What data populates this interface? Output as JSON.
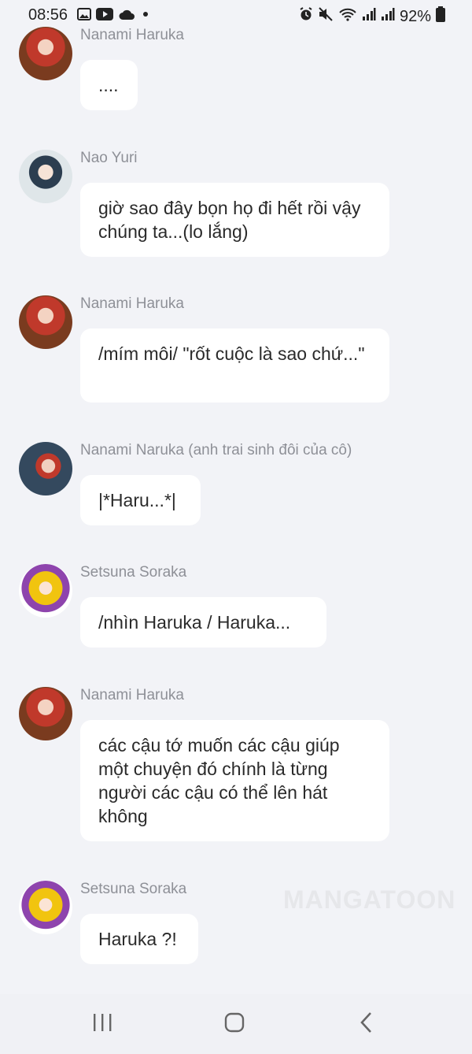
{
  "status_bar": {
    "time": "08:56",
    "battery": "92%",
    "left_icons": [
      "image-icon",
      "youtube-icon",
      "cloud-icon",
      "dot-icon"
    ],
    "right_icons": [
      "alarm-icon",
      "mute-icon",
      "wifi-icon",
      "signal-icon",
      "signal-icon",
      "battery-icon"
    ]
  },
  "messages": [
    {
      "sender": "Nanami Haruka",
      "text": "....",
      "avatar_colors": [
        "#c0392b",
        "#7a3b1f"
      ]
    },
    {
      "sender": "Nao Yuri",
      "text": "giờ sao đây bọn họ đi hết rồi vậy chúng ta...(lo lắng)",
      "avatar_colors": [
        "#2c3e50",
        "#dfe6e9"
      ]
    },
    {
      "sender": "Nanami Haruka",
      "text": "/mím môi/ \"rốt cuộc là sao chứ...\"",
      "avatar_colors": [
        "#c0392b",
        "#7a3b1f"
      ]
    },
    {
      "sender": "Nanami Naruka (anh trai sinh đôi của cô)",
      "text": "|*Haru...*|",
      "avatar_colors": [
        "#34495e",
        "#c0392b"
      ]
    },
    {
      "sender": "Setsuna Soraka",
      "text": "/nhìn Haruka / Haruka...",
      "avatar_colors": [
        "#f1c40f",
        "#8e44ad"
      ]
    },
    {
      "sender": "Nanami Haruka",
      "text": "các cậu tớ muốn các cậu giúp một chuyện đó chính là từng người các cậu có thể lên hát không",
      "avatar_colors": [
        "#c0392b",
        "#7a3b1f"
      ]
    },
    {
      "sender": "Setsuna Soraka",
      "text": "Haruka ?!",
      "avatar_colors": [
        "#f1c40f",
        "#8e44ad"
      ]
    }
  ],
  "watermark": "MANGATOON",
  "nav": {
    "recent": "recent-apps-icon",
    "home": "home-icon",
    "back": "back-icon"
  }
}
